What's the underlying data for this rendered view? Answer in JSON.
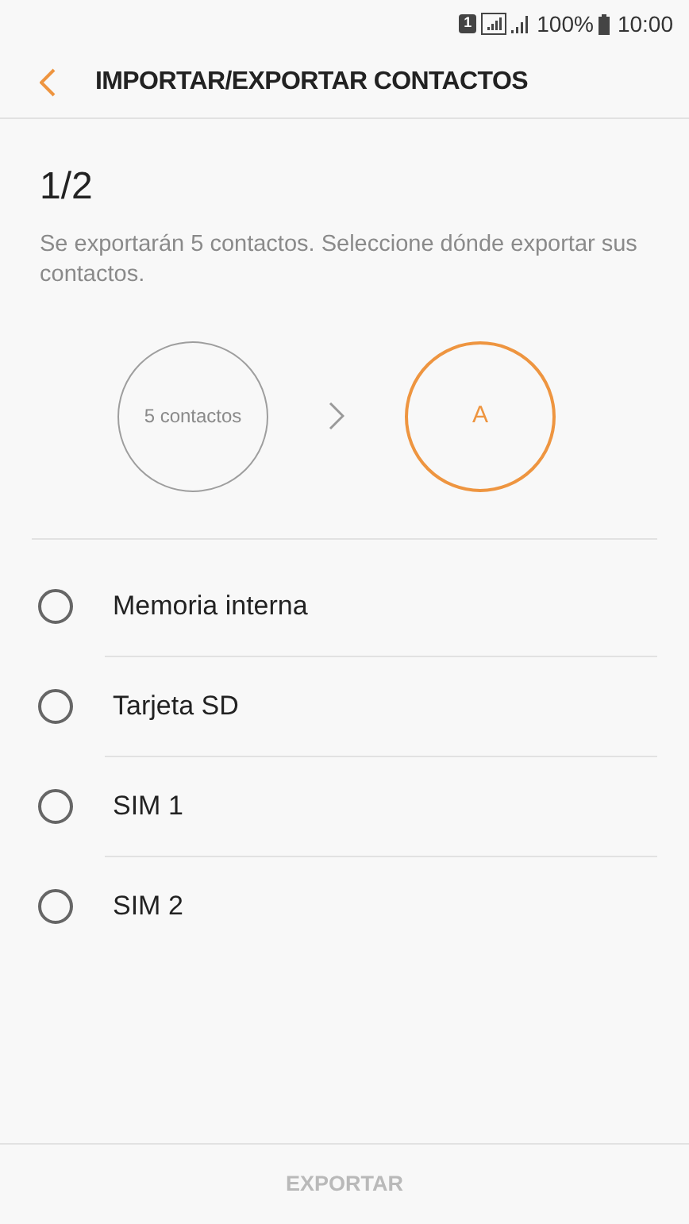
{
  "status_bar": {
    "sim_badge": "1",
    "battery": "100%",
    "time": "10:00"
  },
  "header": {
    "title": "IMPORTAR/EXPORTAR CONTACTOS"
  },
  "step": "1/2",
  "description": "Se exportarán 5 contactos. Seleccione dónde exportar sus contactos.",
  "flow": {
    "source": "5 contactos",
    "target": "A"
  },
  "options": [
    {
      "label": "Memoria interna",
      "selected": false
    },
    {
      "label": "Tarjeta SD",
      "selected": false
    },
    {
      "label": "SIM 1",
      "selected": false
    },
    {
      "label": "SIM 2",
      "selected": false
    }
  ],
  "export_button": {
    "label": "EXPORTAR",
    "disabled": true
  }
}
